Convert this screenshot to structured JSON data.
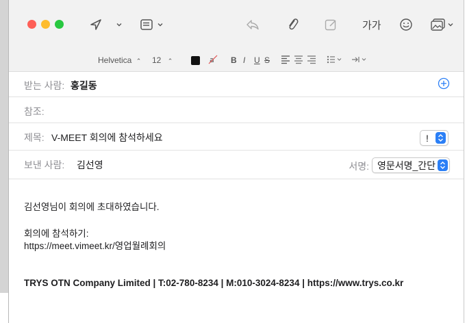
{
  "format_bar": {
    "font": "Helvetica",
    "size": "12",
    "bold": "B",
    "italic": "I",
    "underline": "U",
    "strike": "S"
  },
  "toolbar": {
    "text_size_label": "가가"
  },
  "header": {
    "to_label": "받는 사람:",
    "to_value": "홍길동",
    "cc_label": "참조:",
    "subject_label": "제목:",
    "subject_value": "V-MEET 회의에 참석하세요",
    "priority_value": "!",
    "from_label": "보낸 사람:",
    "from_value": "김선영",
    "signature_label": "서명:",
    "signature_value": "영문서명_간단"
  },
  "message": {
    "line1": "김선영님이 회의에 초대하였습니다.",
    "line2": "회의에 참석하기:",
    "line3": "https://meet.vimeet.kr/영업월례회의",
    "signature": "TRYS OTN Company Limited | T:02-780-8234 | M:010-3024-8234 | https://www.trys.co.kr"
  },
  "colors": {
    "accent": "#2b7ff6",
    "close": "#fe5f57",
    "minimize": "#febc2e",
    "zoom": "#28c840",
    "text_color_swatch": "#111111"
  },
  "icons": [
    "send-icon",
    "header-fields-icon",
    "reply-icon",
    "attachment-icon",
    "markup-icon",
    "emoji-icon",
    "photo-browser-icon",
    "add-contact-icon"
  ]
}
